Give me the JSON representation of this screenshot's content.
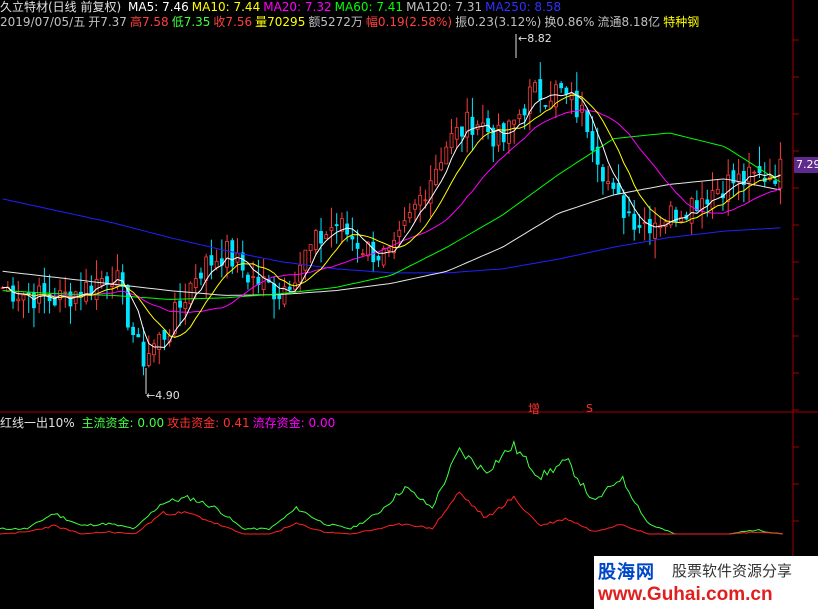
{
  "header": {
    "stock_name": "久立特材(日线 前复权)",
    "ma": [
      {
        "label": "MA5: 7.46",
        "color": "#ffffff"
      },
      {
        "label": "MA10: 7.44",
        "color": "#ffff00"
      },
      {
        "label": "MA20: 7.32",
        "color": "#ff00ff"
      },
      {
        "label": "MA60: 7.41",
        "color": "#00ff00"
      },
      {
        "label": "MA120: 7.31",
        "color": "#c0c0c0"
      },
      {
        "label": "MA250: 8.58",
        "color": "#3030ff"
      }
    ]
  },
  "info": [
    {
      "label": "2019/07/05/五",
      "color": "#c0c0c0"
    },
    {
      "label": "开7.37",
      "color": "#c0c0c0"
    },
    {
      "label": "高7.58",
      "color": "#ff4040"
    },
    {
      "label": "低7.35",
      "color": "#40ff40"
    },
    {
      "label": "收7.56",
      "color": "#ff4040"
    },
    {
      "label": "量70295",
      "color": "#ffff00"
    },
    {
      "label": "额5272万",
      "color": "#c0c0c0"
    },
    {
      "label": "幅0.19(2.58%)",
      "color": "#ff4040"
    },
    {
      "label": "振0.23(3.12%)",
      "color": "#c0c0c0"
    },
    {
      "label": "换0.86%",
      "color": "#c0c0c0"
    },
    {
      "label": "流通8.18亿",
      "color": "#c0c0c0"
    },
    {
      "label": "特种钢",
      "color": "#ffff00"
    }
  ],
  "annotations": {
    "high_label": "8.82",
    "low_label": "4.90",
    "last_price": "7.29",
    "marker_zeng": "增",
    "marker_s": "S"
  },
  "indicator": {
    "title": "红线一出10%",
    "items": [
      {
        "label": "主流资金: 0.00",
        "color": "#40ff40"
      },
      {
        "label": "攻击资金: 0.41",
        "color": "#ff3030"
      },
      {
        "label": "流存资金: 0.00",
        "color": "#ff00ff"
      }
    ]
  },
  "watermark": {
    "brand": "股海网",
    "slogan": "股票软件资源分享",
    "url": "www.Guhai.com.cn"
  },
  "chart_data": {
    "type": "candlestick",
    "price_range": [
      4.6,
      9.3
    ],
    "high": 8.82,
    "low": 4.9,
    "last": 7.29,
    "colors": {
      "up": "#ff3c3c",
      "down": "#00e5ff",
      "ma5": "#ffffff",
      "ma10": "#ffff00",
      "ma20": "#ff00ff",
      "ma60": "#00ff00",
      "ma120": "#e6e6e6",
      "ma250": "#2020ff",
      "main_fund": "#40ff40",
      "attack_fund": "#ff2020"
    },
    "ma120_ctrl": [
      6.3,
      6.22,
      6.14,
      6.06,
      6.0,
      6.01,
      6.06,
      6.15,
      6.3,
      6.6,
      7.02,
      7.25,
      7.38,
      7.45,
      7.31
    ],
    "ma250_ctrl": [
      7.2,
      7.05,
      6.9,
      6.72,
      6.56,
      6.42,
      6.33,
      6.28,
      6.28,
      6.33,
      6.45,
      6.6,
      6.72,
      6.8,
      6.84
    ],
    "ma60_ctrl": [
      6.06,
      6.02,
      6.0,
      5.95,
      5.97,
      6.02,
      6.1,
      6.25,
      6.6,
      7.0,
      7.5,
      7.95,
      8.02,
      7.85,
      7.41
    ],
    "close_ctrl": [
      6.1,
      6.0,
      5.95,
      6.1,
      6.3,
      5.2,
      5.6,
      6.3,
      6.55,
      6.2,
      6.05,
      6.55,
      6.9,
      6.6,
      6.45,
      7.2,
      7.9,
      8.2,
      7.9,
      8.5,
      8.55,
      8.2,
      7.2,
      6.9,
      7.0,
      7.2,
      7.4,
      7.45,
      7.56
    ],
    "indicator_range": [
      0,
      1.0
    ],
    "main_fund_ctrl": [
      0.05,
      0.05,
      0.2,
      0.08,
      0.1,
      0.05,
      0.3,
      0.35,
      0.25,
      0.05,
      0.05,
      0.25,
      0.1,
      0.05,
      0.2,
      0.45,
      0.25,
      0.8,
      0.6,
      0.85,
      0.55,
      0.7,
      0.3,
      0.55,
      0.1,
      0.0,
      0.0,
      0.0,
      0.04,
      0.0
    ],
    "attack_fund_ctrl": [
      0.0,
      0.02,
      0.08,
      0.0,
      0.02,
      0.0,
      0.2,
      0.2,
      0.1,
      0.0,
      0.0,
      0.1,
      0.02,
      0.0,
      0.05,
      0.1,
      0.05,
      0.4,
      0.15,
      0.35,
      0.08,
      0.15,
      0.02,
      0.1,
      0.0,
      0.0,
      0.0,
      0.0,
      0.02,
      0.0
    ]
  }
}
